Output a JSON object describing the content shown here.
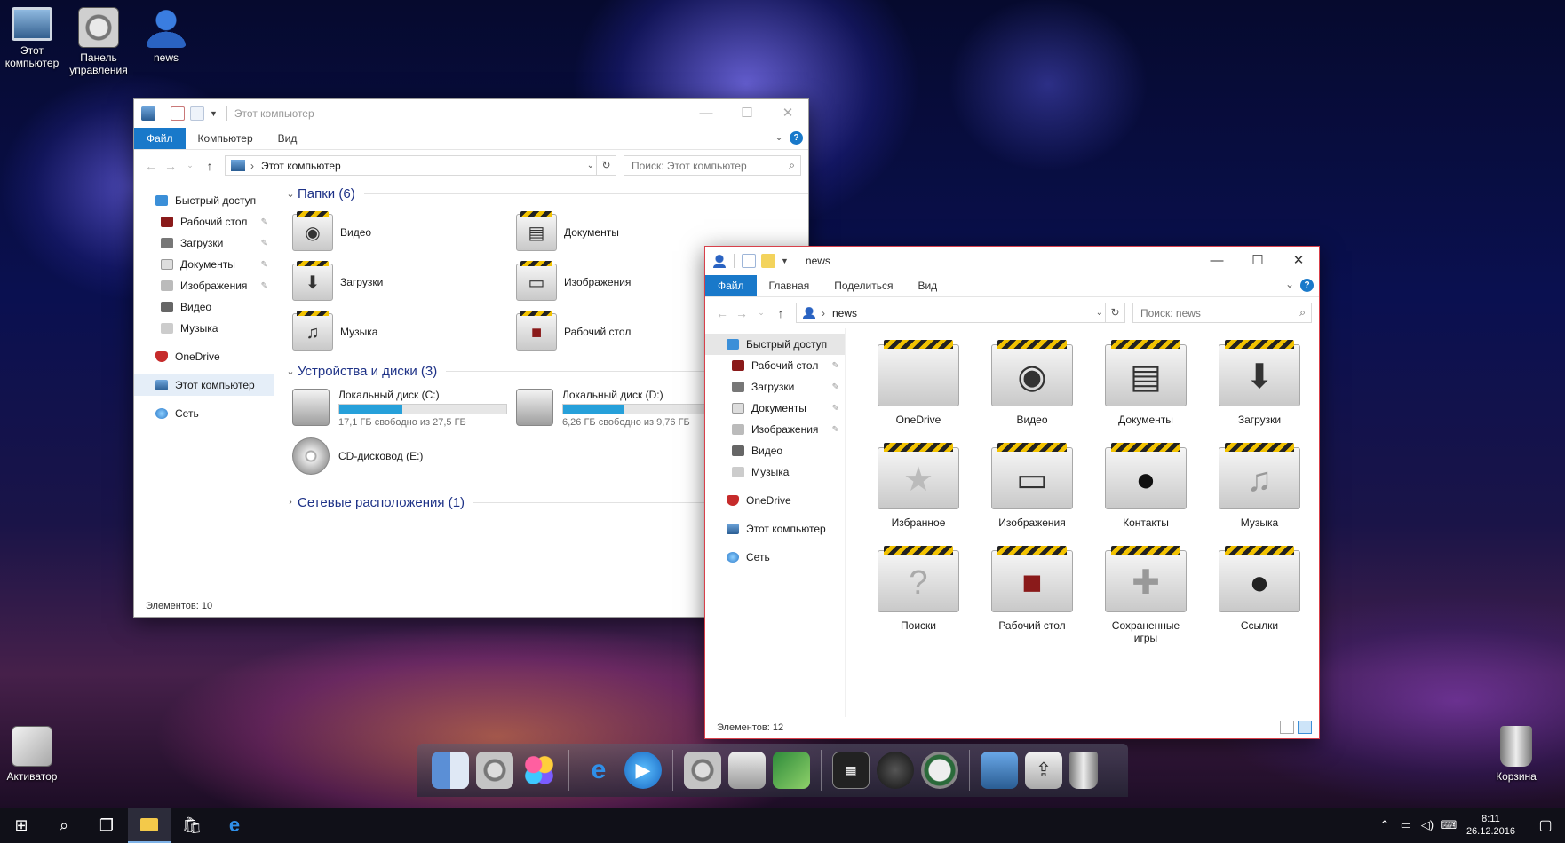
{
  "desktop": {
    "icons": [
      {
        "label": "Этот\nкомпьютер"
      },
      {
        "label": "Панель\nуправления"
      },
      {
        "label": "news"
      },
      {
        "label": "Активатор"
      },
      {
        "label": "Корзина"
      }
    ]
  },
  "win1": {
    "title": "Этот компьютер",
    "tabs": [
      "Файл",
      "Компьютер",
      "Вид"
    ],
    "address": "Этот компьютер",
    "search_placeholder": "Поиск: Этот компьютер",
    "nav": [
      {
        "label": "Быстрый доступ"
      },
      {
        "label": "Рабочий стол"
      },
      {
        "label": "Загрузки"
      },
      {
        "label": "Документы"
      },
      {
        "label": "Изображения"
      },
      {
        "label": "Видео"
      },
      {
        "label": "Музыка"
      },
      {
        "label": "OneDrive"
      },
      {
        "label": "Этот компьютер"
      },
      {
        "label": "Сеть"
      }
    ],
    "group_folders": "Папки (6)",
    "folders": [
      "Видео",
      "Документы",
      "Загрузки",
      "Изображения",
      "Музыка",
      "Рабочий стол"
    ],
    "group_devices": "Устройства и диски (3)",
    "drives": [
      {
        "name": "Локальный диск (C:)",
        "free": "17,1 ГБ свободно из 27,5 ГБ",
        "used_fraction": 0.38
      },
      {
        "name": "Локальный диск (D:)",
        "free": "6,26 ГБ свободно из 9,76 ГБ",
        "used_fraction": 0.36
      },
      {
        "name": "CD-дисковод (E:)"
      }
    ],
    "group_network": "Сетевые расположения (1)",
    "status": "Элементов: 10"
  },
  "win2": {
    "title": "news",
    "tabs": [
      "Файл",
      "Главная",
      "Поделиться",
      "Вид"
    ],
    "address": "news",
    "search_placeholder": "Поиск: news",
    "nav": [
      {
        "label": "Быстрый доступ"
      },
      {
        "label": "Рабочий стол"
      },
      {
        "label": "Загрузки"
      },
      {
        "label": "Документы"
      },
      {
        "label": "Изображения"
      },
      {
        "label": "Видео"
      },
      {
        "label": "Музыка"
      },
      {
        "label": "OneDrive"
      },
      {
        "label": "Этот компьютер"
      },
      {
        "label": "Сеть"
      }
    ],
    "items": [
      "OneDrive",
      "Видео",
      "Документы",
      "Загрузки",
      "Избранное",
      "Изображения",
      "Контакты",
      "Музыка",
      "Поиски",
      "Рабочий стол",
      "Сохраненные игры",
      "Ссылки"
    ],
    "status": "Элементов: 12"
  },
  "taskbar": {
    "time": "8:11",
    "date": "26.12.2016"
  },
  "colors": {
    "ribbon_file_tab": "#1979ca",
    "group_header": "#1e3287",
    "drive_bar": "#26a0da",
    "win2_border": "#d8404a"
  }
}
